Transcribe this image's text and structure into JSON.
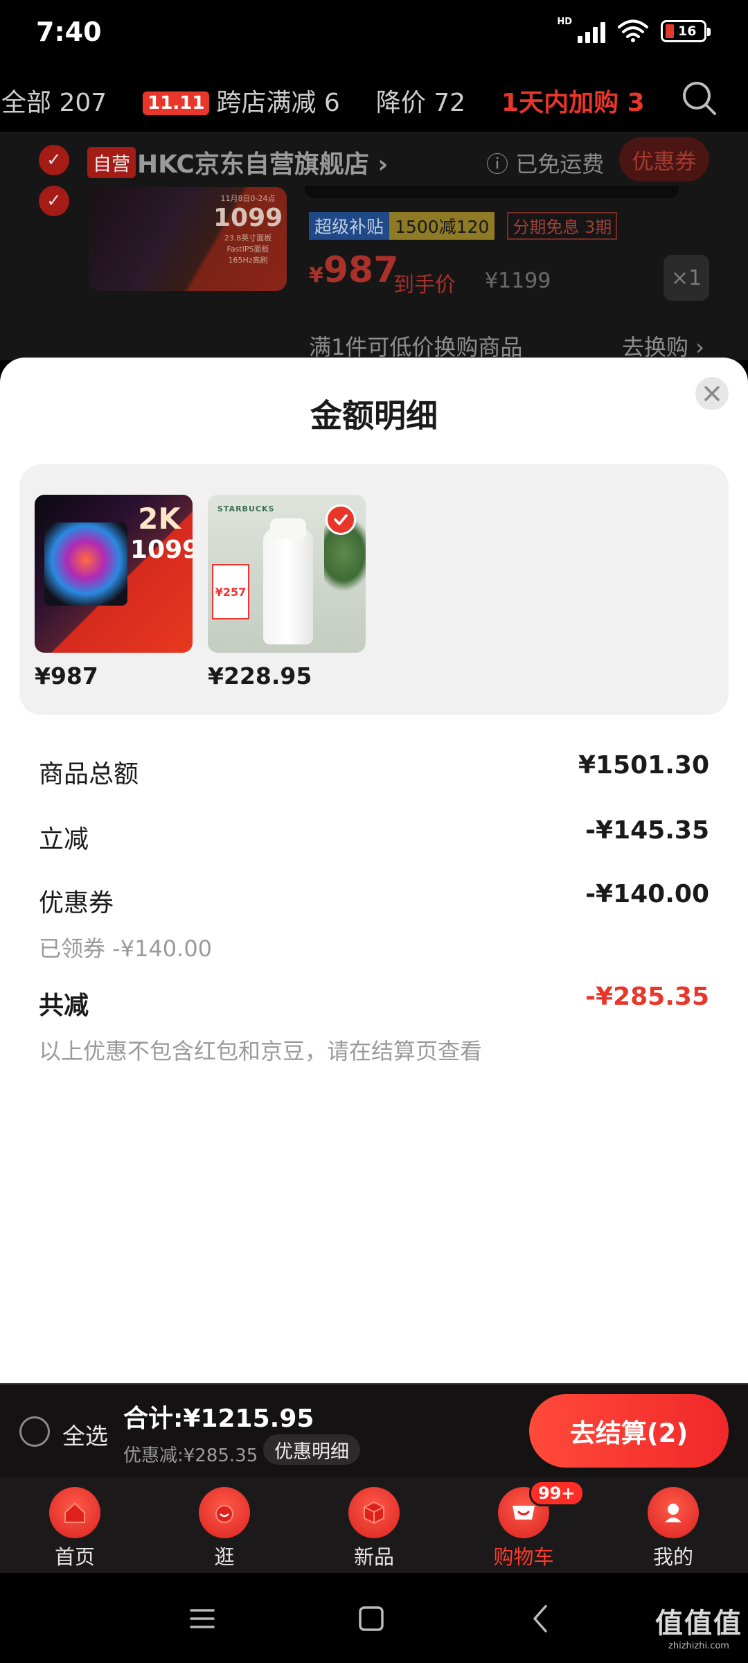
{
  "status_bar": {
    "time": "7:40",
    "network": "HD",
    "battery": "16"
  },
  "filter_tabs": [
    {
      "label": "全部 207",
      "active": false
    },
    {
      "badge": "11.11",
      "label": "跨店满减 6",
      "active": false
    },
    {
      "label": "降价 72",
      "active": false
    },
    {
      "label": "1天内加购 3",
      "active": true
    }
  ],
  "store": {
    "self_tag": "自营",
    "name": "HKC京东自营旗舰店",
    "chevron": "›",
    "free_shipping": "已免运费",
    "coupon_button": "优惠券"
  },
  "cart_item": {
    "image_promo": {
      "date": "11月8日0-24点",
      "price": "1099",
      "spec1": "23.8英寸面板",
      "spec2": "FastIPS面板",
      "spec3": "165Hz高刷"
    },
    "tags": {
      "subsidy": "超级补贴",
      "discount": "1500减120",
      "installment": "分期免息 3期"
    },
    "price_symbol": "¥",
    "price": "987",
    "price_label": "到手价",
    "original_price": "¥1199",
    "quantity": "×1",
    "swap_text": "满1件可低价换购商品",
    "swap_link": "去换购 ›"
  },
  "sheet": {
    "title": "金额明细",
    "products": [
      {
        "price": "¥987",
        "image": "monitor",
        "promo_big": "2K",
        "promo_price": "1099",
        "selected": false
      },
      {
        "price": "¥228.95",
        "image": "bottle",
        "brand": "STARBUCKS",
        "promo_price": "¥257",
        "selected": true
      }
    ],
    "rows": {
      "subtotal": {
        "label": "商品总额",
        "value": "¥1501.30"
      },
      "instant": {
        "label": "立减",
        "value": "-¥145.35"
      },
      "coupon": {
        "label": "优惠券",
        "value": "-¥140.00",
        "sub": "已领券 -¥140.00"
      },
      "total_discount": {
        "label": "共减",
        "value": "-¥285.35",
        "note": "以上优惠不包含红包和京豆，请在结算页查看"
      }
    }
  },
  "action_bar": {
    "select_all": "全选",
    "total": "合计:¥1215.95",
    "discount": "优惠减:¥285.35",
    "detail_button": "优惠明细",
    "checkout": "去结算(2)"
  },
  "bottom_nav": [
    {
      "label": "首页",
      "icon": "home-icon",
      "active": false
    },
    {
      "label": "逛",
      "icon": "browse-icon",
      "active": false
    },
    {
      "label": "新品",
      "icon": "new-products-icon",
      "active": false
    },
    {
      "label": "购物车",
      "icon": "cart-icon",
      "active": true,
      "badge": "99+"
    },
    {
      "label": "我的",
      "icon": "profile-icon",
      "active": false
    }
  ],
  "watermark": {
    "main": "值值值",
    "sub": "zhizhizhi.com"
  },
  "colors": {
    "accent": "#e9362b",
    "dark_bg": "#161616",
    "sheet_bg": "#ffffff",
    "panel_bg": "#f1f1f1"
  }
}
